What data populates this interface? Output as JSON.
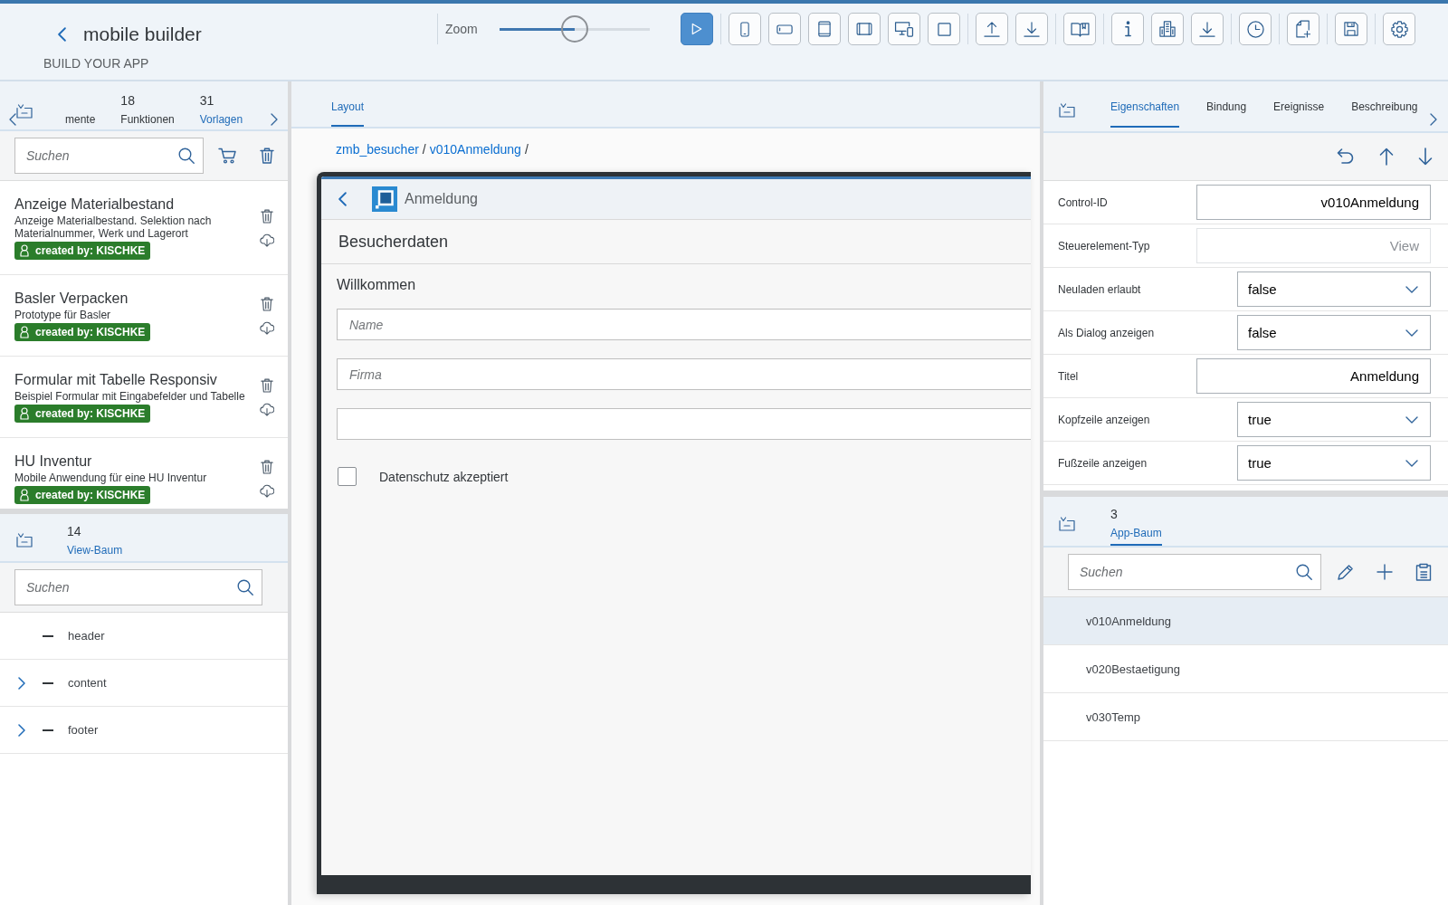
{
  "header": {
    "title": "mobile builder",
    "subtitle": "BUILD YOUR APP",
    "zoom": {
      "label": "Zoom",
      "level": 0.5
    }
  },
  "templates_panel": {
    "tabs": [
      {
        "label": "mente",
        "selected": false
      },
      {
        "count": "18",
        "label": "Funktionen",
        "selected": false
      },
      {
        "count": "31",
        "label": "Vorlagen",
        "selected": true
      }
    ],
    "search": {
      "placeholder": "Suchen"
    },
    "templates": [
      {
        "title": "Anzeige Materialbestand",
        "description": "Anzeige Materialbestand. Selektion nach Materialnummer, Werk und Lagerort",
        "author": "created by: KISCHKE"
      },
      {
        "title": "Basler Verpacken",
        "description": "Prototype für Basler",
        "author": "created by: KISCHKE"
      },
      {
        "title": "Formular mit Tabelle Responsiv",
        "description": "Beispiel Formular mit Eingabefelder und Tabelle",
        "author": "created by: KISCHKE"
      },
      {
        "title": "HU Inventur",
        "description": "Mobile Anwendung für eine HU Inventur",
        "author": "created by: KISCHKE"
      }
    ]
  },
  "view_tree": {
    "tabs": [
      {
        "count": "14",
        "label": "View-Baum",
        "selected": true
      }
    ],
    "search": {
      "placeholder": "Suchen"
    },
    "nodes": [
      {
        "label": "header",
        "kind": "leaf",
        "expanded": false
      },
      {
        "label": "content",
        "kind": "branch",
        "expanded": false
      },
      {
        "label": "footer",
        "kind": "branch",
        "expanded": false
      }
    ]
  },
  "layout_panel": {
    "tabs": [
      {
        "label": "Layout",
        "selected": true
      }
    ],
    "breadcrumb": [
      {
        "kind": "link",
        "text": "zmb_besucher"
      },
      {
        "kind": "separator",
        "text": "/"
      },
      {
        "kind": "link",
        "text": "v010Anmeldung"
      },
      {
        "kind": "separator",
        "text": "/"
      }
    ],
    "preview": {
      "title": "Anmeldung",
      "page_title": "Besucherdaten",
      "section_title": "Willkommen",
      "fields": [
        {
          "kind": "input",
          "placeholder": "Name"
        },
        {
          "kind": "input",
          "placeholder": "Firma"
        },
        {
          "kind": "input"
        }
      ],
      "checkbox": {
        "label": "Datenschutz akzeptiert",
        "checked": false
      }
    }
  },
  "properties_panel": {
    "tabs": [
      {
        "label": "Eigenschaften",
        "selected": true
      },
      {
        "label": "Bindung",
        "selected": false
      },
      {
        "label": "Ereignisse",
        "selected": false
      },
      {
        "label": "Beschreibung",
        "selected": false
      }
    ],
    "properties": [
      {
        "label": "Control-ID",
        "kind": "input",
        "value": "v010Anmeldung",
        "disabled": false
      },
      {
        "label": "Steuerelement-Typ",
        "kind": "input",
        "value": "View",
        "disabled": true
      },
      {
        "label": "Neuladen erlaubt",
        "kind": "select",
        "value": "false",
        "disabled": false
      },
      {
        "label": "Als Dialog anzeigen",
        "kind": "select",
        "value": "false",
        "disabled": false
      },
      {
        "label": "Titel",
        "kind": "input",
        "value": "Anmeldung",
        "disabled": false
      },
      {
        "label": "Kopfzeile anzeigen",
        "kind": "select",
        "value": "true",
        "disabled": false
      },
      {
        "label": "Fußzeile anzeigen",
        "kind": "select",
        "value": "true",
        "disabled": false
      }
    ]
  },
  "app_tree": {
    "tabs": [
      {
        "count": "3",
        "label": "App-Baum",
        "selected": true
      }
    ],
    "search": {
      "placeholder": "Suchen"
    },
    "views": [
      {
        "label": "v010Anmeldung",
        "selected": true
      },
      {
        "label": "v020Bestaetigung",
        "selected": false
      },
      {
        "label": "v030Temp",
        "selected": false
      }
    ]
  }
}
